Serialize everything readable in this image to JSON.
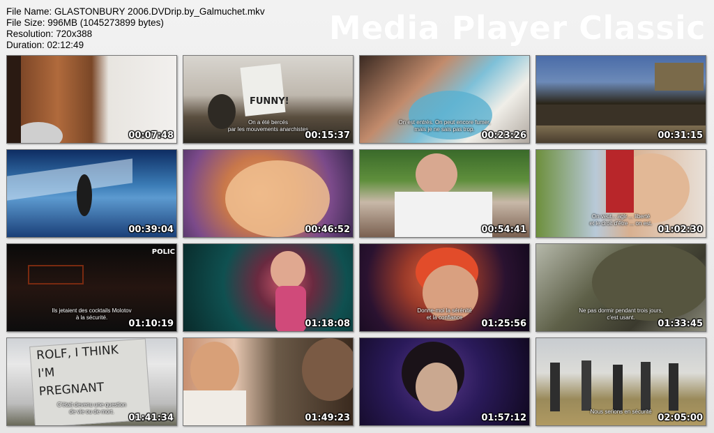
{
  "info": {
    "file_name": "File Name: GLASTONBURY 2006.DVDrip.by_Galmuchet.mkv",
    "file_size": "File Size: 996MB (1045273899 bytes)",
    "resolution": "Resolution: 720x388",
    "duration": "Duration: 02:12:49"
  },
  "watermark": "Media Player Classic",
  "thumbnails": [
    {
      "time": "00:07:48",
      "subtitle": ""
    },
    {
      "time": "00:15:37",
      "subtitle": "On a été bercés\npar les mouvements anarchistes",
      "sign_text": "FUNNY!"
    },
    {
      "time": "00:23:26",
      "subtitle": "On est entrés. On peut encore fumer,\nmais je ne sais pas trop."
    },
    {
      "time": "00:31:15",
      "subtitle": ""
    },
    {
      "time": "00:39:04",
      "subtitle": ""
    },
    {
      "time": "00:46:52",
      "subtitle": ""
    },
    {
      "time": "00:54:41",
      "subtitle": ""
    },
    {
      "time": "01:02:30",
      "subtitle": "On veut... agir ... liberté\net le droit d'être ... on est."
    },
    {
      "time": "01:10:19",
      "subtitle": "Ils jetaient des cocktails Molotov\nà la sécurité.",
      "sign_text": "POLIC"
    },
    {
      "time": "01:18:08",
      "subtitle": ""
    },
    {
      "time": "01:25:56",
      "subtitle": "Donne-moi la sérénité\net la confiance"
    },
    {
      "time": "01:33:45",
      "subtitle": "Ne pas dormir pendant trois jours,\nc'est usant."
    },
    {
      "time": "01:41:34",
      "subtitle": "C'était devenu une question\nde vie ou de mort.",
      "sign_text": "ROLF, I THINK\nI'M\nPREGNANT"
    },
    {
      "time": "01:49:23",
      "subtitle": ""
    },
    {
      "time": "01:57:12",
      "subtitle": ""
    },
    {
      "time": "02:05:00",
      "subtitle": "Nous serions en sécurité"
    }
  ]
}
